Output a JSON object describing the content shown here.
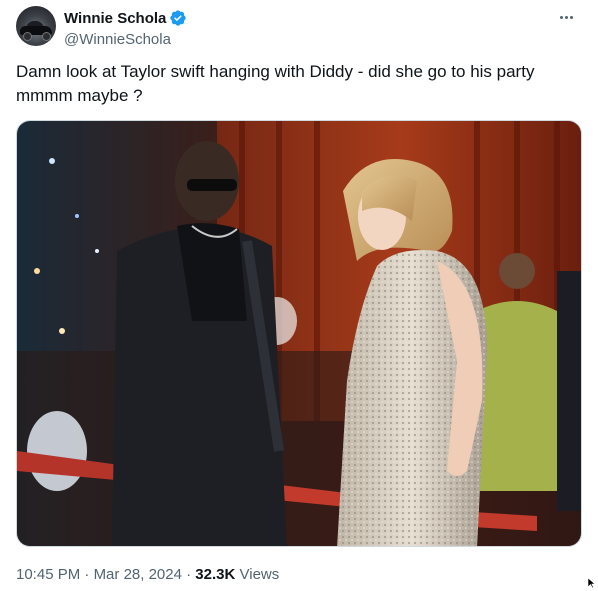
{
  "author": {
    "display_name": "Winnie Schola",
    "handle": "@WinnieSchola",
    "verified_color": "#1d9bf0",
    "avatar_icon": "car-avatar"
  },
  "tweet": {
    "text": "Damn look at Taylor swift hanging with Diddy - did she go to his party mmmm maybe ?",
    "media_description_icon": "photo",
    "time": "10:45 PM",
    "date": "Mar 28, 2024",
    "views_count": "32.3K",
    "views_label": "Views",
    "separator": "·"
  },
  "colors": {
    "text_primary": "#0f1419",
    "text_secondary": "#536471",
    "border": "#cfd9de"
  },
  "icons": [
    "verified-badge-icon",
    "more-icon",
    "cursor-icon"
  ]
}
